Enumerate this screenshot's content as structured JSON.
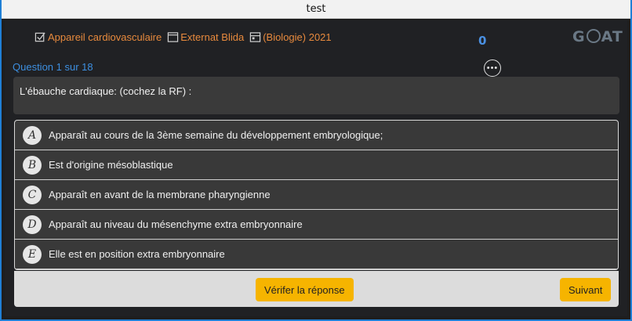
{
  "window": {
    "title": "test"
  },
  "breadcrumbs": [
    {
      "label": "Appareil cardiovasculaire",
      "icon": "checkbox-icon"
    },
    {
      "label": "Externat Blida",
      "icon": "book-icon"
    },
    {
      "label": "(Biologie) 2021",
      "icon": "calendar-icon"
    }
  ],
  "score": "0",
  "logo": {
    "text_left": "G",
    "text_right": "AT"
  },
  "question_counter": "Question 1 sur 18",
  "comment_icon": "comment-icon",
  "question": {
    "text": "L'ébauche cardiaque: (cochez la RF) :"
  },
  "choices": [
    {
      "letter": "A",
      "text": "Apparaît au cours de la 3ème semaine du développement embryologique;"
    },
    {
      "letter": "B",
      "text": "Est d'origine mésoblastique"
    },
    {
      "letter": "C",
      "text": "Apparaît en avant de la membrane pharyngienne"
    },
    {
      "letter": "D",
      "text": "Apparaît au niveau du mésenchyme extra embryonnaire"
    },
    {
      "letter": "E",
      "text": "Elle est en position extra embryonnaire"
    }
  ],
  "buttons": {
    "verify": "Vérifer la réponse",
    "next": "Suivant"
  },
  "colors": {
    "accent": "#f6b400",
    "crumb": "#e88a3d",
    "link": "#3d8fe0",
    "window_border": "#1f7fd6"
  }
}
